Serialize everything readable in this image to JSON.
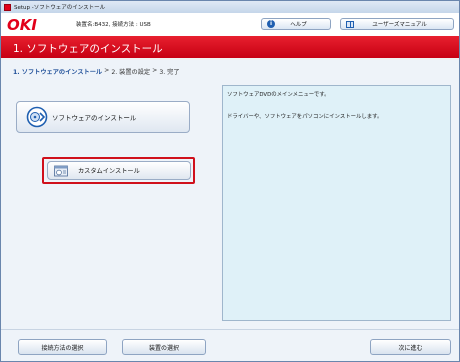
{
  "window": {
    "title": "Setup -ソフトウェアのインストール"
  },
  "header": {
    "logo": "OKI",
    "device_info": "装置名:B432, 接続方法 : USB",
    "help_label": "ヘルプ",
    "manual_label": "ユーザーズマニュアル"
  },
  "banner": {
    "title": "1. ソフトウェアのインストール"
  },
  "breadcrumb": {
    "step1": "1. ソフトウェアのインストール",
    "sep1": ">",
    "step2": "2. 装置の設定",
    "sep2": ">",
    "step3": "3. 完了"
  },
  "buttons": {
    "install_software": "ソフトウェアのインストール",
    "custom_install": "カスタムインストール"
  },
  "description": {
    "line1": "ソフトウェアDVDのメインメニューです。",
    "line2": "ドライバーや、ソフトウェアをパソコンにインストールします。"
  },
  "footer": {
    "connection_method": "接続方法の選択",
    "device_select": "装置の選択",
    "next": "次に進む"
  },
  "colors": {
    "brand_red": "#e2001a",
    "accent_blue": "#1f4f99",
    "panel_bg": "#dff1f8"
  },
  "icons": {
    "help": "help-icon",
    "manual": "manual-book-icon",
    "install": "software-install-icon",
    "custom": "custom-install-icon"
  }
}
